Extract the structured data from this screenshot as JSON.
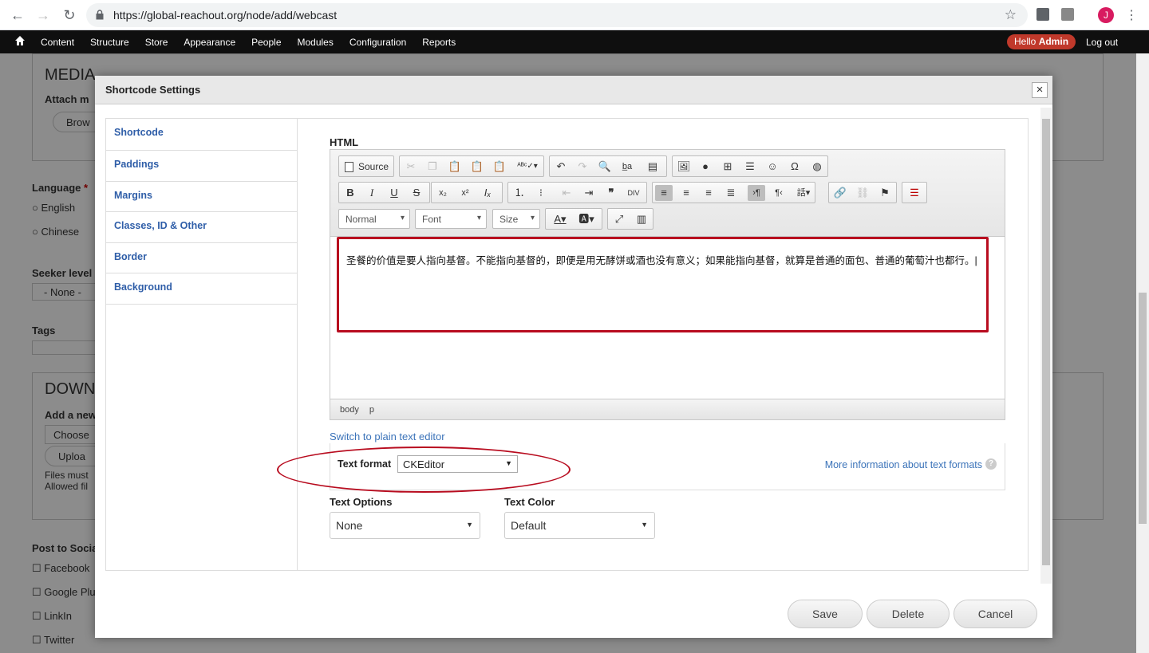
{
  "browser": {
    "url": "https://global-reachout.org/node/add/webcast",
    "avatar_letter": "J"
  },
  "admin_toolbar": {
    "menu": [
      "Content",
      "Structure",
      "Store",
      "Appearance",
      "People",
      "Modules",
      "Configuration",
      "Reports"
    ],
    "hello_prefix": "Hello ",
    "hello_user": "Admin",
    "logout": "Log out"
  },
  "background_page": {
    "media_heading": "MEDIA",
    "attach_label": "Attach m",
    "browse_label": "Brow",
    "language_label": "Language",
    "required_mark": "*",
    "language_options": [
      "English",
      "Chinese"
    ],
    "seeker_label": "Seeker level",
    "seeker_value": "- None -",
    "tags_label": "Tags",
    "download_heading": "DOWN",
    "add_new_label": "Add a new",
    "choose_label": "Choose",
    "upload_label": "Uploa",
    "files_note_1": "Files must",
    "files_note_2": "Allowed fil",
    "post_social_label": "Post to Socia",
    "social_options": [
      "Facebook",
      "Google Plu",
      "LinkIn",
      "Twitter"
    ]
  },
  "dialog": {
    "title": "Shortcode Settings",
    "close": "×",
    "tabs": [
      "Shortcode",
      "Paddings",
      "Margins",
      "Classes, ID & Other",
      "Border",
      "Background"
    ],
    "html_label": "HTML",
    "editor": {
      "source_label": "Source",
      "format_combo": "Normal",
      "font_combo": "Font",
      "size_combo": "Size",
      "content": "圣餐的价值是要人指向基督。不能指向基督的，即便是用无酵饼或酒也没有意义；如果能指向基督，就算是普通的面包、普通的葡萄汁也都行。|",
      "path": [
        "body",
        "p"
      ]
    },
    "switch_link": "Switch to plain text editor",
    "text_format_label": "Text format",
    "text_format_value": "CKEditor",
    "more_info": "More information about text formats",
    "help_icon_glyph": "?",
    "text_options_label": "Text Options",
    "text_options_value": "None",
    "text_color_label": "Text Color",
    "text_color_value": "Default",
    "buttons": {
      "save": "Save",
      "delete": "Delete",
      "cancel": "Cancel"
    }
  },
  "colors": {
    "highlight_red": "#b80c1f",
    "link_blue": "#3b73b9",
    "hello_badge": "#c0392b"
  }
}
